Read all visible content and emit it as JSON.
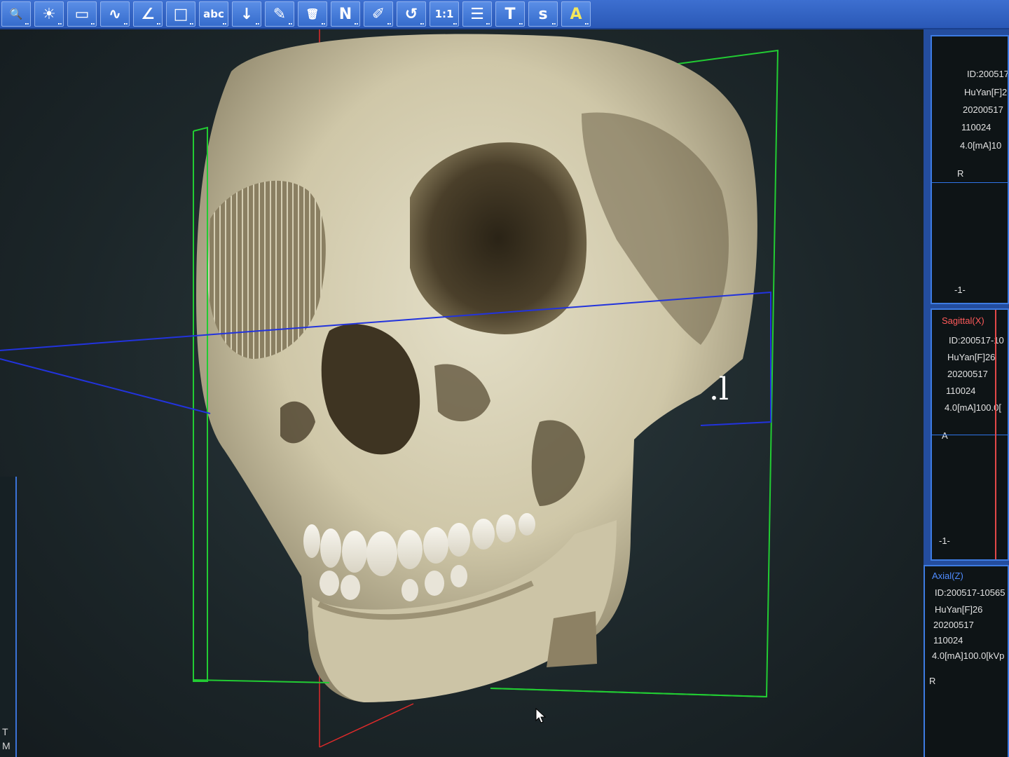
{
  "toolbar": {
    "tools": [
      {
        "name": "zoom",
        "glyph": "🔍"
      },
      {
        "name": "brightness",
        "glyph": "☀"
      },
      {
        "name": "ruler",
        "glyph": "▭"
      },
      {
        "name": "curve",
        "glyph": "∿"
      },
      {
        "name": "angle",
        "glyph": "∠"
      },
      {
        "name": "rectangle",
        "glyph": "□"
      },
      {
        "name": "text-label",
        "glyph": "abc"
      },
      {
        "name": "arrow",
        "glyph": "↓"
      },
      {
        "name": "pencil",
        "glyph": "✎"
      },
      {
        "name": "delete",
        "glyph": "🗑"
      },
      {
        "name": "north",
        "glyph": "N"
      },
      {
        "name": "pen",
        "glyph": "✐"
      },
      {
        "name": "undo",
        "glyph": "↺"
      },
      {
        "name": "actual-size",
        "glyph": "1:1"
      },
      {
        "name": "report",
        "glyph": "☰"
      },
      {
        "name": "text",
        "glyph": "T"
      },
      {
        "name": "s-tool",
        "glyph": "s"
      },
      {
        "name": "annotation",
        "glyph": "A"
      }
    ]
  },
  "viewport": {
    "overlay_text": ".l"
  },
  "left_strip": {
    "labels": [
      "T",
      "M"
    ]
  },
  "views": [
    {
      "title": "",
      "lines": [
        "ID:200517",
        "HuYan[F]2",
        "20200517",
        "110024",
        "4.0[mA]10"
      ],
      "orientation": "R",
      "scale": "-1-"
    },
    {
      "title": "Sagittal(X)",
      "lines": [
        "ID:200517-10",
        "HuYan[F]26",
        "20200517",
        "110024",
        "4.0[mA]100.0["
      ],
      "orientation": "A",
      "scale": "-1-"
    },
    {
      "title": "Axial(Z)",
      "lines": [
        "ID:200517-10565",
        "HuYan[F]26",
        "20200517",
        "110024",
        "4.0[mA]100.0[kVp"
      ],
      "orientation": "R",
      "scale": ""
    }
  ],
  "colors": {
    "toolbar": "#2f62c4",
    "frame_green": "#22cc33",
    "plane_blue": "#2233dd",
    "plane_red": "#e02a2a",
    "bone": "#d8d2b8",
    "sagittal_title": "#ff5a5a",
    "axial_title": "#4f8cff"
  }
}
